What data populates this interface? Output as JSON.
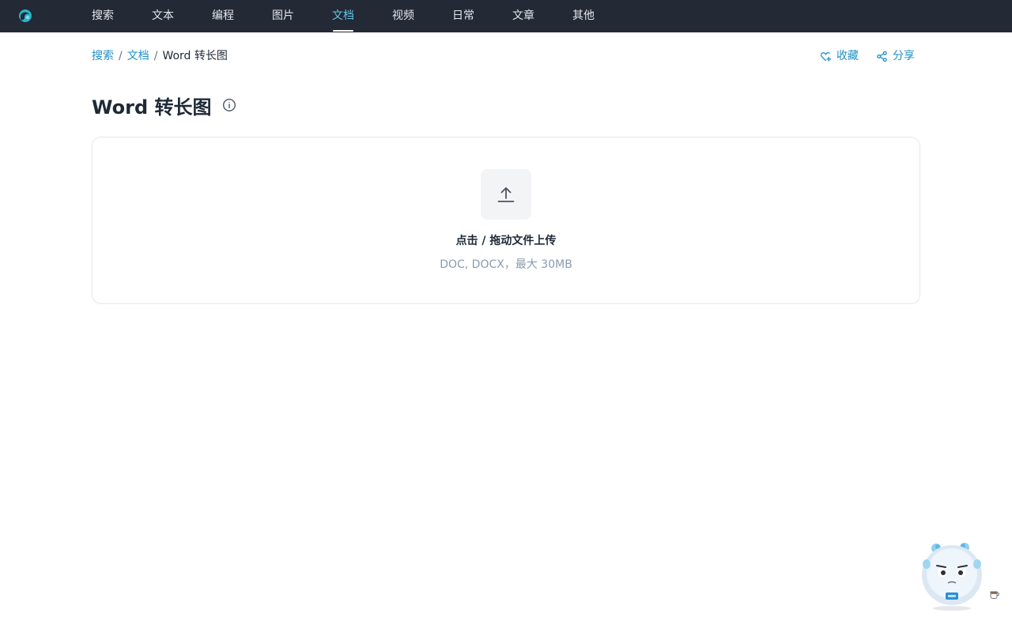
{
  "nav": {
    "items": [
      {
        "label": "搜索",
        "active": false
      },
      {
        "label": "文本",
        "active": false
      },
      {
        "label": "编程",
        "active": false
      },
      {
        "label": "图片",
        "active": false
      },
      {
        "label": "文档",
        "active": true
      },
      {
        "label": "视频",
        "active": false
      },
      {
        "label": "日常",
        "active": false
      },
      {
        "label": "文章",
        "active": false
      },
      {
        "label": "其他",
        "active": false
      }
    ]
  },
  "breadcrumb": {
    "items": [
      {
        "label": "搜索"
      },
      {
        "label": "文档"
      },
      {
        "label": "Word 转长图"
      }
    ],
    "separator": "/"
  },
  "actions": {
    "favorite_label": "收藏",
    "share_label": "分享"
  },
  "page": {
    "title": "Word 转长图"
  },
  "upload": {
    "title": "点击 / 拖动文件上传",
    "hint": "DOC, DOCX，最大 30MB"
  },
  "icons": {
    "logo": "logo-icon",
    "favorite": "heart-plus-icon",
    "share": "share-icon",
    "info": "info-icon",
    "upload": "upload-arrow-icon",
    "coffee": "coffee-icon"
  },
  "colors": {
    "topbar_bg": "#232935",
    "nav_text": "#e5e7eb",
    "nav_active": "#5ec9e8",
    "link": "#1e90c8",
    "hint": "#8a9bb0"
  }
}
